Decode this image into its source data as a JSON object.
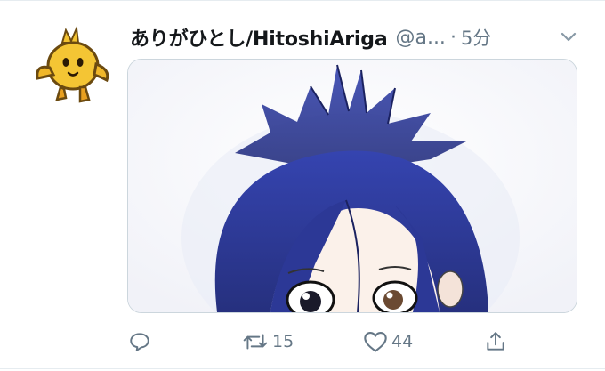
{
  "tweet": {
    "display_name": "ありがひとし/HitoshiAriga",
    "handle": "@a...",
    "separator": "·",
    "timestamp": "5分",
    "avatar_icon": "chick-mascot-icon",
    "caret_icon": "chevron-down-icon",
    "media_alt": "illustration-blue-haired-character"
  },
  "actions": {
    "reply_icon": "reply-icon",
    "retweet_icon": "retweet-icon",
    "retweet_count": "15",
    "like_icon": "heart-icon",
    "like_count": "44",
    "share_icon": "share-icon"
  },
  "colors": {
    "text_primary": "#14171a",
    "text_secondary": "#657786",
    "border": "#ccd6dd",
    "hair_blue": "#2f3d9c"
  }
}
